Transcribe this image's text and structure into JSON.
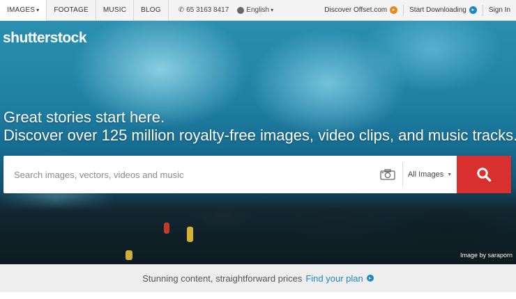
{
  "topbar": {
    "nav": [
      {
        "label": "IMAGES",
        "has_dropdown": true,
        "active": true
      },
      {
        "label": "FOOTAGE"
      },
      {
        "label": "MUSIC"
      },
      {
        "label": "BLOG"
      }
    ],
    "phone": "65 3163 8417",
    "language": "English",
    "offset_link": "Discover Offset.com",
    "start_link": "Start Downloading",
    "signin": "Sign In"
  },
  "hero": {
    "logo": "shutterstock",
    "headline": "Great stories start here.",
    "subheadline": "Discover over 125 million royalty-free images, video clips, and music tracks.",
    "search": {
      "placeholder": "Search images, vectors, videos and music",
      "value": "",
      "type_selected": "All Images"
    },
    "credit": "Image by saraporn"
  },
  "strip": {
    "text": "Stunning content, straightforward prices",
    "link": "Find your plan"
  },
  "colors": {
    "search_button": "#d8302f",
    "link_blue": "#1d86c8",
    "offset_orange": "#e58a1f"
  }
}
